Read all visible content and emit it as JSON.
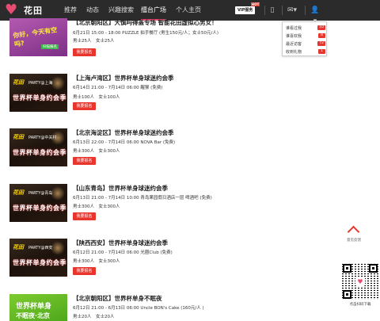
{
  "nav": {
    "logo_text": "花田",
    "links": [
      "推荐",
      "动态",
      "兴趣搜索",
      "擂台广场",
      "个人主页"
    ],
    "vip_label": "VIP服务",
    "vip_hot": "HOT"
  },
  "dropdown": {
    "items": [
      {
        "label": "谁看过我",
        "count": "10"
      },
      {
        "label": "谁喜欢我",
        "count": "8"
      },
      {
        "label": "最近访客",
        "count": "72"
      },
      {
        "label": "收到礼物",
        "count": "1"
      }
    ]
  },
  "events": [
    {
      "title": "【北京朝阳区】大慎吗得盖专场 智能花田虚拟心男女！",
      "date_line": "6月21日 15:00 - 18:00 PUZZLE 拍手餐厅 (男生150元/人；女士50元/人)",
      "quota": "男士25人　女士25人",
      "button": "我要报名",
      "thumb": {
        "style": "purple",
        "line1": "你好，今天有空吗?",
        "tag": "扫描报名"
      }
    },
    {
      "title": "【上海卢湾区】世界杯单身球迷约会季",
      "date_line": "6月14日 21:00 - 7月14日 06:00 醒猴 (免费)",
      "quota": "男士100人　女士100人",
      "button": "我要报名",
      "thumb": {
        "style": "dark",
        "line1": "花田",
        "line2": "PARTY@上海",
        "line3": "世界杯单身约会季"
      }
    },
    {
      "title": "【北京海淀区】世界杯单身球迷约会季",
      "date_line": "6月13日 22:00 - 7月14日 06:00 NOVA Bar (免费)",
      "quota": "男士300人　女士300人",
      "button": "我要报名",
      "thumb": {
        "style": "dark",
        "line1": "花田",
        "line2": "PARTY@中关村",
        "line3": "世界杯单身约会季"
      }
    },
    {
      "title": "【山东青岛】世界杯单身球迷约会季",
      "date_line": "6月13日 21:00 - 7月14日 10:00 青岛果园假日酒店一层 啤酒吧 (免费)",
      "quota": "男士300人　女士300人",
      "button": "我要报名",
      "thumb": {
        "style": "dark",
        "line1": "花田",
        "line2": "PARTY@青岛",
        "line3": "世界杯单身约会季"
      }
    },
    {
      "title": "【陕西西安】世界杯单身球迷约会季",
      "date_line": "6月12日 21:00 - 7月14日 06:00 光圈Club (免费)",
      "quota": "男士300人　女士300人",
      "button": "我要报名",
      "thumb": {
        "style": "dark",
        "line1": "花田",
        "line2": "PARTY@西安",
        "line3": "世界杯单身约会季"
      }
    },
    {
      "title": "【北京朝阳区】世界杯单身不眠夜",
      "date_line": "6月12日 21:00 - 6月13日 06:00 Uncle BON's Cake (160元/人 )",
      "quota": "男士20人　女士20人",
      "button": "我要报名",
      "thumb": {
        "style": "green",
        "line1": "世界杯单身",
        "line2": "不眠夜·北京"
      }
    }
  ],
  "sidebar": {
    "feedback_label": "意见反馈",
    "qr_label": "点击扫码下载"
  }
}
